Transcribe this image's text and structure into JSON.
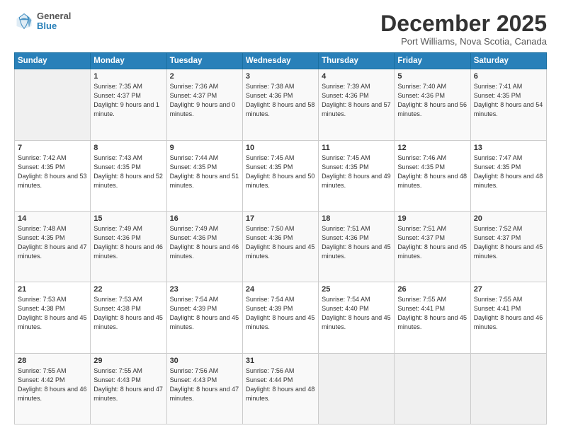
{
  "header": {
    "logo": {
      "general": "General",
      "blue": "Blue"
    },
    "title": "December 2025",
    "location": "Port Williams, Nova Scotia, Canada"
  },
  "weekdays": [
    "Sunday",
    "Monday",
    "Tuesday",
    "Wednesday",
    "Thursday",
    "Friday",
    "Saturday"
  ],
  "weeks": [
    [
      {
        "day": "",
        "sunrise": "",
        "sunset": "",
        "daylight": ""
      },
      {
        "day": "1",
        "sunrise": "Sunrise: 7:35 AM",
        "sunset": "Sunset: 4:37 PM",
        "daylight": "Daylight: 9 hours and 1 minute."
      },
      {
        "day": "2",
        "sunrise": "Sunrise: 7:36 AM",
        "sunset": "Sunset: 4:37 PM",
        "daylight": "Daylight: 9 hours and 0 minutes."
      },
      {
        "day": "3",
        "sunrise": "Sunrise: 7:38 AM",
        "sunset": "Sunset: 4:36 PM",
        "daylight": "Daylight: 8 hours and 58 minutes."
      },
      {
        "day": "4",
        "sunrise": "Sunrise: 7:39 AM",
        "sunset": "Sunset: 4:36 PM",
        "daylight": "Daylight: 8 hours and 57 minutes."
      },
      {
        "day": "5",
        "sunrise": "Sunrise: 7:40 AM",
        "sunset": "Sunset: 4:36 PM",
        "daylight": "Daylight: 8 hours and 56 minutes."
      },
      {
        "day": "6",
        "sunrise": "Sunrise: 7:41 AM",
        "sunset": "Sunset: 4:35 PM",
        "daylight": "Daylight: 8 hours and 54 minutes."
      }
    ],
    [
      {
        "day": "7",
        "sunrise": "Sunrise: 7:42 AM",
        "sunset": "Sunset: 4:35 PM",
        "daylight": "Daylight: 8 hours and 53 minutes."
      },
      {
        "day": "8",
        "sunrise": "Sunrise: 7:43 AM",
        "sunset": "Sunset: 4:35 PM",
        "daylight": "Daylight: 8 hours and 52 minutes."
      },
      {
        "day": "9",
        "sunrise": "Sunrise: 7:44 AM",
        "sunset": "Sunset: 4:35 PM",
        "daylight": "Daylight: 8 hours and 51 minutes."
      },
      {
        "day": "10",
        "sunrise": "Sunrise: 7:45 AM",
        "sunset": "Sunset: 4:35 PM",
        "daylight": "Daylight: 8 hours and 50 minutes."
      },
      {
        "day": "11",
        "sunrise": "Sunrise: 7:45 AM",
        "sunset": "Sunset: 4:35 PM",
        "daylight": "Daylight: 8 hours and 49 minutes."
      },
      {
        "day": "12",
        "sunrise": "Sunrise: 7:46 AM",
        "sunset": "Sunset: 4:35 PM",
        "daylight": "Daylight: 8 hours and 48 minutes."
      },
      {
        "day": "13",
        "sunrise": "Sunrise: 7:47 AM",
        "sunset": "Sunset: 4:35 PM",
        "daylight": "Daylight: 8 hours and 48 minutes."
      }
    ],
    [
      {
        "day": "14",
        "sunrise": "Sunrise: 7:48 AM",
        "sunset": "Sunset: 4:35 PM",
        "daylight": "Daylight: 8 hours and 47 minutes."
      },
      {
        "day": "15",
        "sunrise": "Sunrise: 7:49 AM",
        "sunset": "Sunset: 4:36 PM",
        "daylight": "Daylight: 8 hours and 46 minutes."
      },
      {
        "day": "16",
        "sunrise": "Sunrise: 7:49 AM",
        "sunset": "Sunset: 4:36 PM",
        "daylight": "Daylight: 8 hours and 46 minutes."
      },
      {
        "day": "17",
        "sunrise": "Sunrise: 7:50 AM",
        "sunset": "Sunset: 4:36 PM",
        "daylight": "Daylight: 8 hours and 45 minutes."
      },
      {
        "day": "18",
        "sunrise": "Sunrise: 7:51 AM",
        "sunset": "Sunset: 4:36 PM",
        "daylight": "Daylight: 8 hours and 45 minutes."
      },
      {
        "day": "19",
        "sunrise": "Sunrise: 7:51 AM",
        "sunset": "Sunset: 4:37 PM",
        "daylight": "Daylight: 8 hours and 45 minutes."
      },
      {
        "day": "20",
        "sunrise": "Sunrise: 7:52 AM",
        "sunset": "Sunset: 4:37 PM",
        "daylight": "Daylight: 8 hours and 45 minutes."
      }
    ],
    [
      {
        "day": "21",
        "sunrise": "Sunrise: 7:53 AM",
        "sunset": "Sunset: 4:38 PM",
        "daylight": "Daylight: 8 hours and 45 minutes."
      },
      {
        "day": "22",
        "sunrise": "Sunrise: 7:53 AM",
        "sunset": "Sunset: 4:38 PM",
        "daylight": "Daylight: 8 hours and 45 minutes."
      },
      {
        "day": "23",
        "sunrise": "Sunrise: 7:54 AM",
        "sunset": "Sunset: 4:39 PM",
        "daylight": "Daylight: 8 hours and 45 minutes."
      },
      {
        "day": "24",
        "sunrise": "Sunrise: 7:54 AM",
        "sunset": "Sunset: 4:39 PM",
        "daylight": "Daylight: 8 hours and 45 minutes."
      },
      {
        "day": "25",
        "sunrise": "Sunrise: 7:54 AM",
        "sunset": "Sunset: 4:40 PM",
        "daylight": "Daylight: 8 hours and 45 minutes."
      },
      {
        "day": "26",
        "sunrise": "Sunrise: 7:55 AM",
        "sunset": "Sunset: 4:41 PM",
        "daylight": "Daylight: 8 hours and 45 minutes."
      },
      {
        "day": "27",
        "sunrise": "Sunrise: 7:55 AM",
        "sunset": "Sunset: 4:41 PM",
        "daylight": "Daylight: 8 hours and 46 minutes."
      }
    ],
    [
      {
        "day": "28",
        "sunrise": "Sunrise: 7:55 AM",
        "sunset": "Sunset: 4:42 PM",
        "daylight": "Daylight: 8 hours and 46 minutes."
      },
      {
        "day": "29",
        "sunrise": "Sunrise: 7:55 AM",
        "sunset": "Sunset: 4:43 PM",
        "daylight": "Daylight: 8 hours and 47 minutes."
      },
      {
        "day": "30",
        "sunrise": "Sunrise: 7:56 AM",
        "sunset": "Sunset: 4:43 PM",
        "daylight": "Daylight: 8 hours and 47 minutes."
      },
      {
        "day": "31",
        "sunrise": "Sunrise: 7:56 AM",
        "sunset": "Sunset: 4:44 PM",
        "daylight": "Daylight: 8 hours and 48 minutes."
      },
      {
        "day": "",
        "sunrise": "",
        "sunset": "",
        "daylight": ""
      },
      {
        "day": "",
        "sunrise": "",
        "sunset": "",
        "daylight": ""
      },
      {
        "day": "",
        "sunrise": "",
        "sunset": "",
        "daylight": ""
      }
    ]
  ]
}
